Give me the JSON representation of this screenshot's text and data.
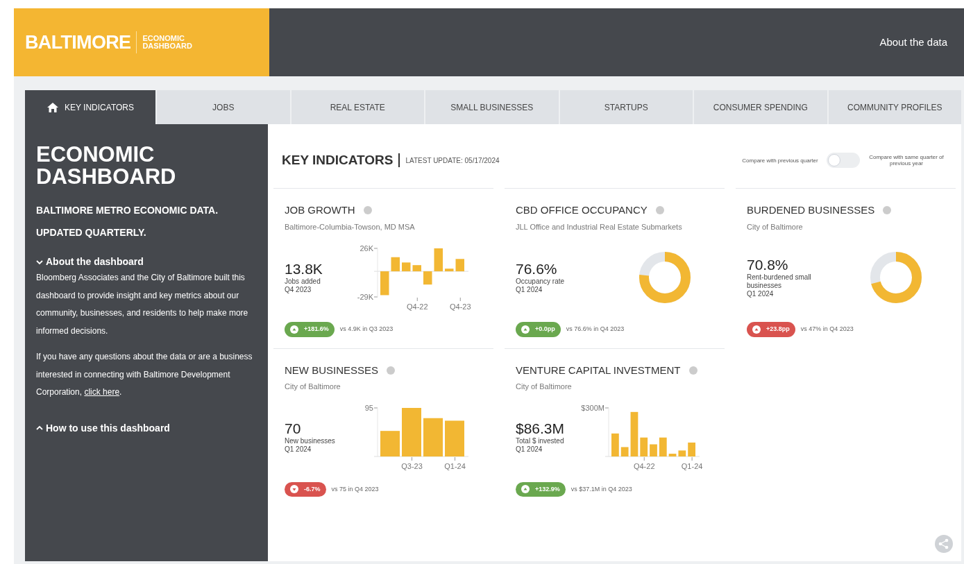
{
  "header": {
    "brand": "BALTIMORE",
    "brand_sub_1": "ECONOMIC",
    "brand_sub_2": "DASHBOARD",
    "link": "About the data"
  },
  "tabs": [
    {
      "label": "KEY INDICATORS",
      "selected": true,
      "icon": true
    },
    {
      "label": "JOBS",
      "selected": false
    },
    {
      "label": "REAL ESTATE",
      "selected": false
    },
    {
      "label": "SMALL BUSINESSES",
      "selected": false
    },
    {
      "label": "STARTUPS",
      "selected": false
    },
    {
      "label": "CONSUMER SPENDING",
      "selected": false
    },
    {
      "label": "COMMUNITY PROFILES",
      "selected": false
    }
  ],
  "sidebar": {
    "title": "ECONOMIC DASHBOARD",
    "subtitle": "BALTIMORE METRO ECONOMIC DATA. UPDATED QUARTERLY.",
    "sections": [
      {
        "label": "About the dashboard",
        "expanded": true,
        "paragraphs": [
          {
            "text": "Bloomberg Associates and the City of Baltimore built this dashboard to provide insight and key metrics about our community, businesses, and residents to help make more informed decisions."
          },
          {
            "text": "If you have any questions about the data or are a business interested in connecting with Baltimore Development Corporation,",
            "link": "click here",
            "after": "."
          }
        ]
      },
      {
        "label": "How to use this dashboard",
        "expanded": false
      }
    ]
  },
  "main": {
    "title": "KEY INDICATORS",
    "update": "LATEST UPDATE: 05/17/2024",
    "compare": {
      "left": "Compare with previous quarter",
      "right": "Compare with same quarter of previous year",
      "on": false
    },
    "cards": [
      {
        "kind": "bars",
        "title": "JOB GROWTH",
        "source": "Baltimore-Columbia-Towson, MD MSA",
        "value": "13.8K",
        "label": "Jobs added",
        "period": "Q4 2023",
        "badge": {
          "text": "+181.6%",
          "rising": true,
          "color": "#6aa84f"
        },
        "comparison": "vs 4.9K in Q3 2023",
        "chart_data": {
          "type": "bar",
          "categories": [
            null,
            null,
            null,
            "Q4-22",
            null,
            null,
            null,
            "Q4-23"
          ],
          "values": [
            -27,
            16,
            10,
            7,
            -15,
            26,
            3,
            14
          ],
          "ylim": [
            -29,
            26
          ],
          "yticks": [
            {
              "value": 26,
              "label": "26K"
            },
            {
              "value": -29,
              "label": "-29K"
            }
          ]
        }
      },
      {
        "kind": "donut",
        "title": "CBD OFFICE OCCUPANCY",
        "source": "JLL Office and Industrial Real Estate Submarkets",
        "value": "76.6%",
        "label": "Occupancy rate",
        "period": "Q1 2024",
        "level": 0.766,
        "badge": {
          "text": "+0.0pp",
          "rising": true,
          "color": "#6aa84f"
        },
        "comparison": "vs 76.6% in Q4 2023"
      },
      {
        "kind": "donut",
        "title": "BURDENED BUSINESSES",
        "source": "City of Baltimore",
        "value": "70.8%",
        "label": "Rent-burdened small businesses",
        "period": "Q1 2024",
        "level": 0.708,
        "badge": {
          "text": "+23.8pp",
          "rising": true,
          "color": "#d9534f"
        },
        "comparison": "vs 47% in Q4 2023"
      },
      {
        "kind": "bars",
        "title": "NEW BUSINESSES",
        "source": "City of Baltimore",
        "value": "70",
        "label": "New businesses",
        "period": "Q1 2024",
        "badge": {
          "text": "-6.7%",
          "rising": false,
          "color": "#d9534f"
        },
        "comparison": "vs 75 in Q4 2023",
        "chart_data": {
          "type": "bar",
          "categories": [
            null,
            "Q3-23",
            null,
            "Q1-24"
          ],
          "values": [
            50,
            95,
            75,
            70
          ],
          "ylim": [
            0,
            95
          ],
          "yticks": [
            {
              "value": 95,
              "label": "95"
            }
          ]
        }
      },
      {
        "kind": "bars",
        "title": "VENTURE CAPITAL INVESTMENT",
        "source": "City of Baltimore",
        "value": "$86.3M",
        "label": "Total $ invested",
        "period": "Q1 2024",
        "badge": {
          "text": "+132.9%",
          "rising": true,
          "color": "#6aa84f"
        },
        "comparison": "vs $37.1M in Q4 2023",
        "chart_data": {
          "type": "bar",
          "categories": [
            null,
            null,
            null,
            "Q4-22",
            null,
            null,
            null,
            null,
            "Q1-24"
          ],
          "values": [
            142,
            58,
            275,
            117,
            75,
            117,
            17,
            37,
            86
          ],
          "ylim": [
            0,
            300
          ],
          "yticks": [
            {
              "value": 300,
              "label": "$300M"
            }
          ]
        }
      }
    ]
  }
}
